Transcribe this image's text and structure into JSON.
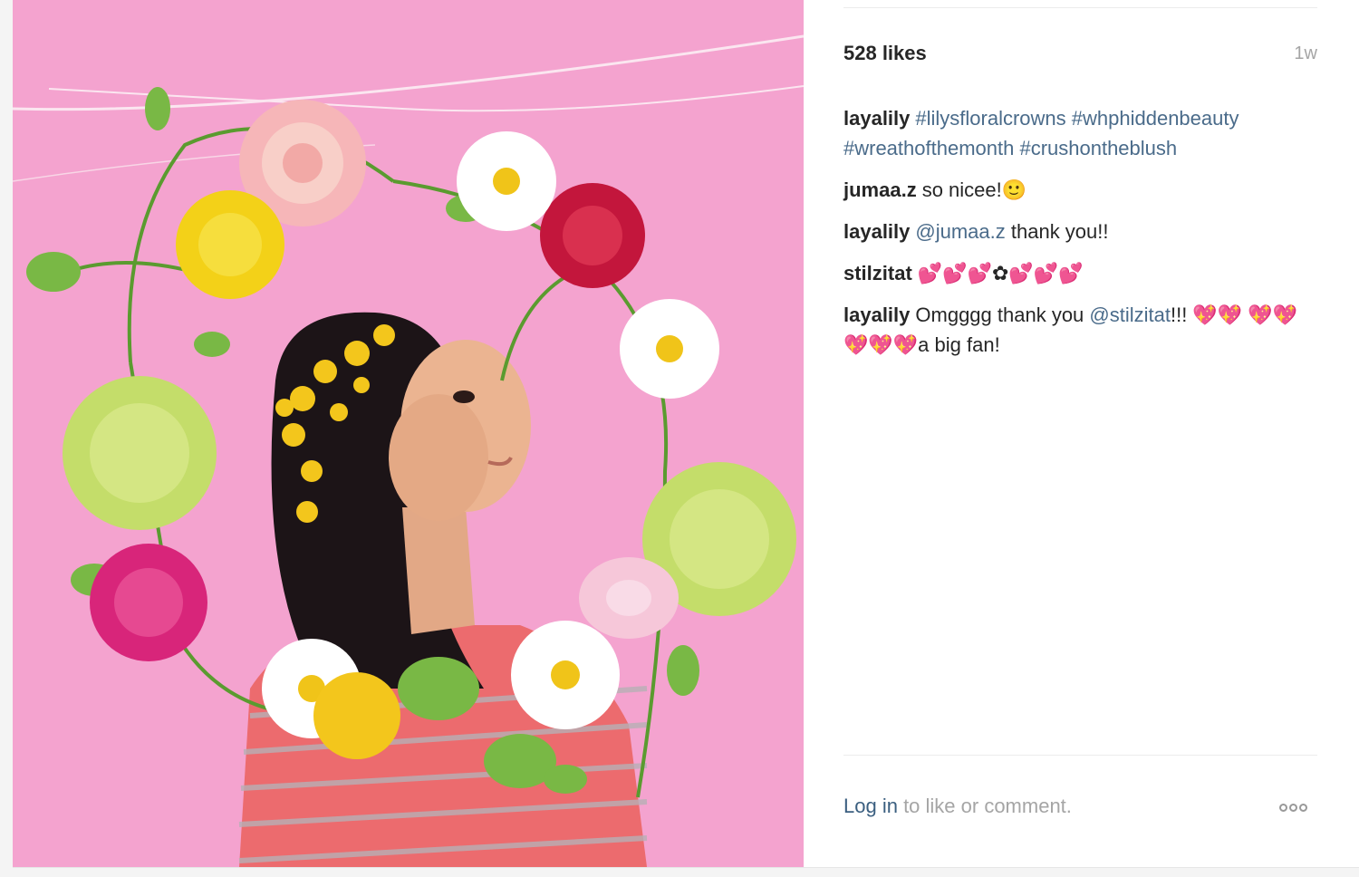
{
  "post": {
    "likes": "528 likes",
    "age": "1w"
  },
  "comments": [
    {
      "user": "layalily",
      "parts": [
        {
          "type": "tag",
          "text": "#lilysfloralcrowns #whphiddenbeauty #wreathofthemonth #crushontheblush"
        }
      ]
    },
    {
      "user": "jumaa.z",
      "parts": [
        {
          "type": "text",
          "text": "so nicee!🙂"
        }
      ]
    },
    {
      "user": "layalily",
      "parts": [
        {
          "type": "tag",
          "text": "@jumaa.z"
        },
        {
          "type": "text",
          "text": " thank you!!"
        }
      ]
    },
    {
      "user": "stilzitat",
      "parts": [
        {
          "type": "text",
          "text": "💕💕💕✿💕💕💕"
        }
      ]
    },
    {
      "user": "layalily",
      "parts": [
        {
          "type": "text",
          "text": "Omgggg thank you "
        },
        {
          "type": "tag",
          "text": "@stilzitat"
        },
        {
          "type": "text",
          "text": "!!! 💖💖 💖💖💖💖💖a big fan!"
        }
      ]
    }
  ],
  "footer": {
    "login_label": "Log in",
    "rest_label": " to like or comment."
  },
  "colors": {
    "photo_background": "#f4a3cf",
    "link": "#3b5f80",
    "hashtag": "#4a6b8a",
    "muted": "#a5a5a5"
  },
  "icons": {
    "more": "more-options-icon"
  }
}
